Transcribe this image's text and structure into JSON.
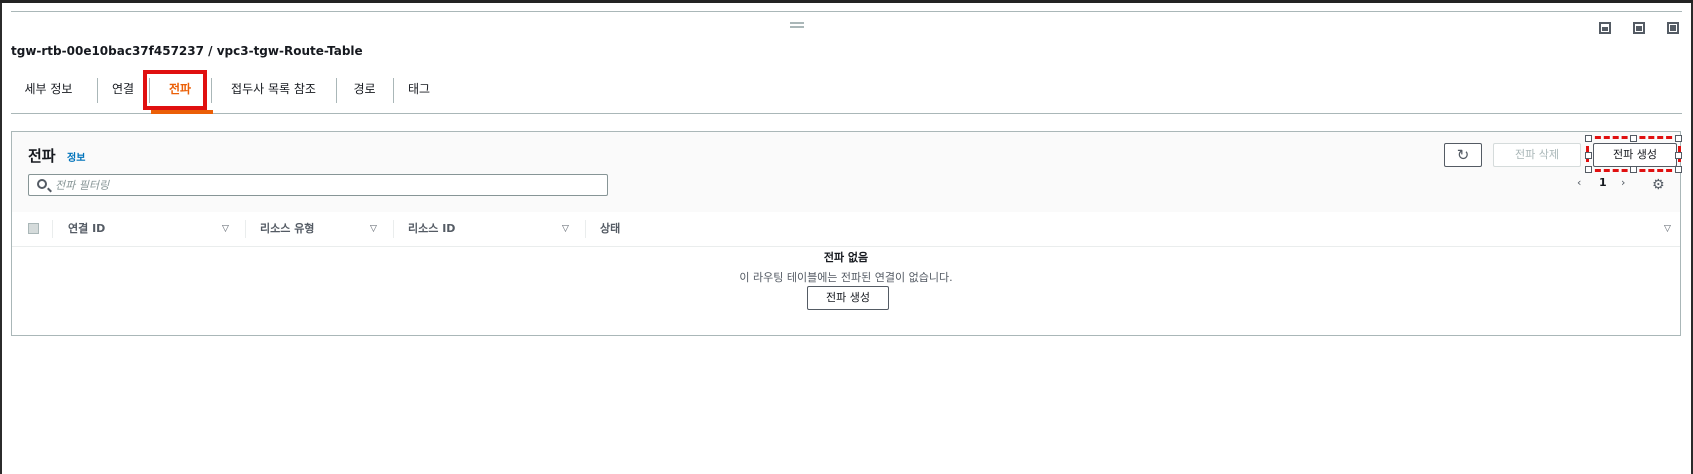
{
  "page": {
    "title": "tgw-rtb-00e10bac37f457237 / vpc3-tgw-Route-Table"
  },
  "tabs": [
    {
      "label": "세부 정보"
    },
    {
      "label": "연결"
    },
    {
      "label": "전파",
      "active": true
    },
    {
      "label": "접두사 목록 참조"
    },
    {
      "label": "경로"
    },
    {
      "label": "태그"
    }
  ],
  "propagation": {
    "title": "전파",
    "info_label": "정보",
    "refresh_icon": "refresh-icon",
    "delete_label": "전파 삭제",
    "create_label": "전파 생성",
    "filter_placeholder": "전파 필터링",
    "page_number": "1",
    "columns": [
      "연결 ID",
      "리소스 유형",
      "리소스 ID",
      "상태"
    ],
    "empty_title": "전파 없음",
    "empty_desc": "이 라우팅 테이블에는 전파된 연결이 없습니다.",
    "empty_button": "전파 생성"
  },
  "colors": {
    "active_tab": "#eb5f07",
    "highlight": "#e01010",
    "link": "#0073bb"
  }
}
